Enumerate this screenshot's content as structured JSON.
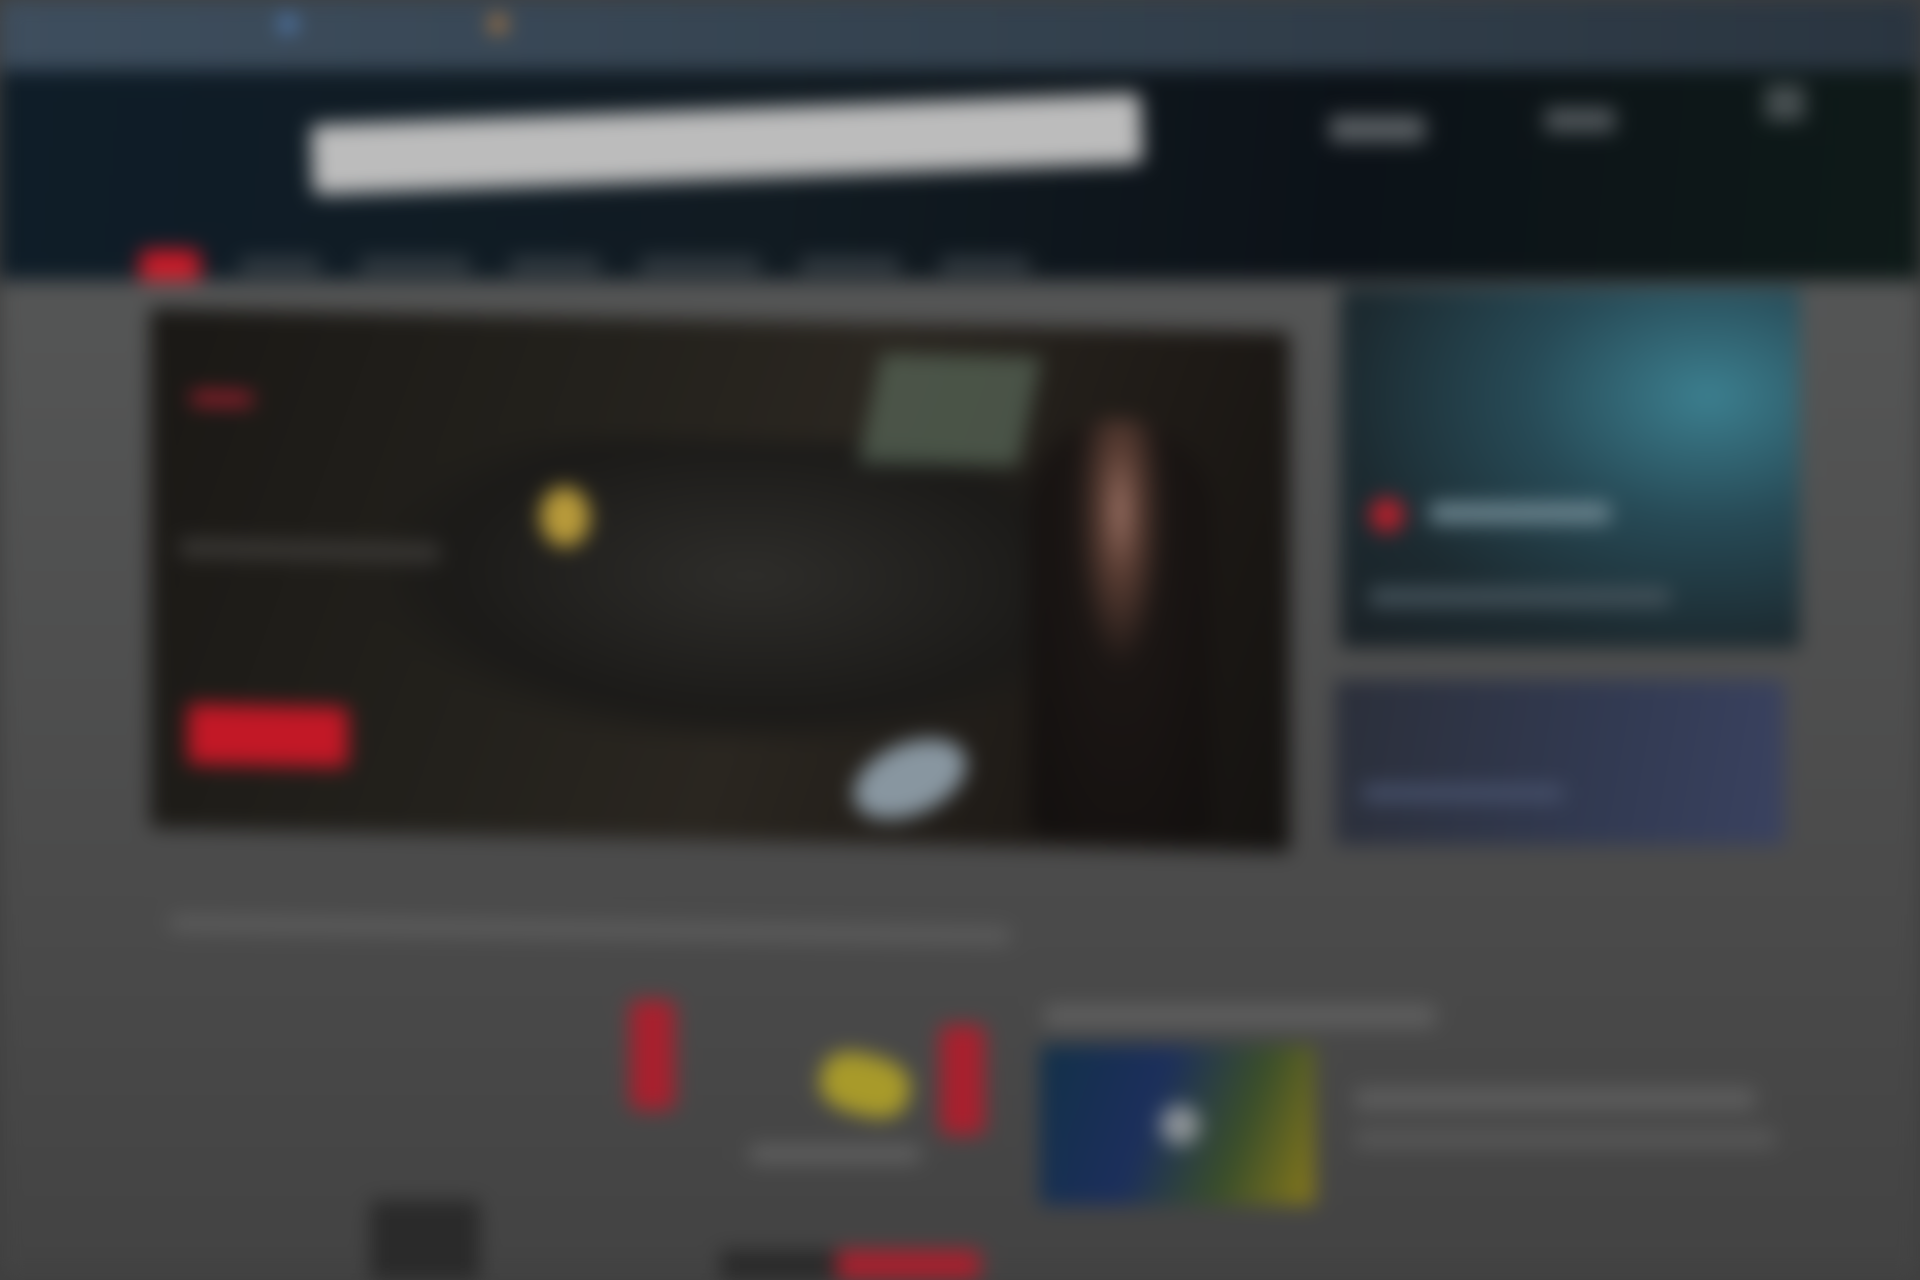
{
  "browser": {
    "background_color": "#3e4e5e"
  },
  "header": {
    "logo_text": "",
    "search": {
      "value": "",
      "placeholder": ""
    },
    "links": [
      "",
      ""
    ],
    "menu_icon": "hamburger-menu-icon"
  },
  "nav": {
    "badge_color": "#cc1a28",
    "items": [
      "",
      "",
      "",
      "",
      "",
      ""
    ]
  },
  "hero": {
    "title": "",
    "subtitle": "",
    "cta_label": "",
    "cta_color": "#c21826"
  },
  "side_cards": [
    {
      "title": "",
      "meta": "",
      "icon": "red-circle-icon"
    },
    {
      "title": "",
      "meta": ""
    }
  ],
  "section": {
    "heading": ""
  },
  "featured": {
    "heading": "",
    "title": "",
    "subtitle": "",
    "thumb_icon": "play-icon"
  },
  "colors": {
    "accent": "#c21826",
    "header_bg": "#0f1d28",
    "page_bg": "#4a4a4a"
  }
}
